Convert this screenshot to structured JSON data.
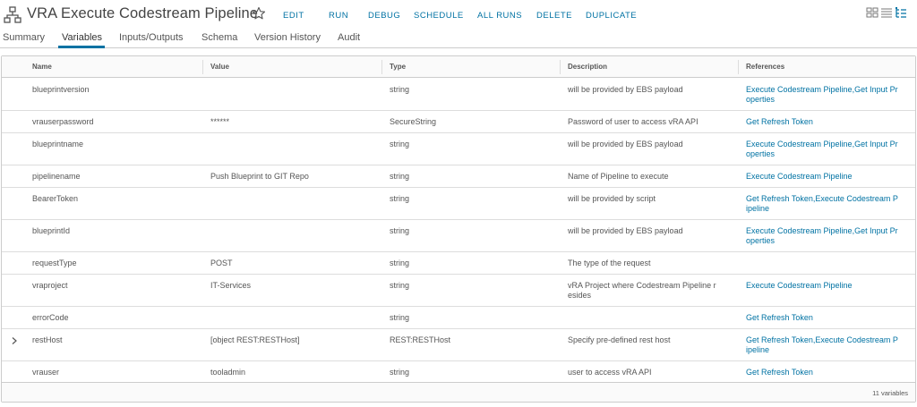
{
  "header": {
    "title": "VRA Execute Codestream Pipeline",
    "actions": [
      "EDIT",
      "RUN",
      "DEBUG",
      "SCHEDULE",
      "ALL RUNS",
      "DELETE",
      "DUPLICATE"
    ],
    "view_toggles": [
      "card-view-icon",
      "list-view-icon",
      "tree-view-icon"
    ]
  },
  "tabs": [
    {
      "label": "Summary",
      "active": false
    },
    {
      "label": "Variables",
      "active": true
    },
    {
      "label": "Inputs/Outputs",
      "active": false
    },
    {
      "label": "Schema",
      "active": false
    },
    {
      "label": "Version History",
      "active": false
    },
    {
      "label": "Audit",
      "active": false
    }
  ],
  "grid": {
    "columns": [
      "Name",
      "Value",
      "Type",
      "Description",
      "References"
    ],
    "rows": [
      {
        "name": "blueprintversion",
        "value": "",
        "type": "string",
        "description": "will be provided by EBS payload",
        "references": "Execute Codestream Pipeline,Get Input Pr operties",
        "expandable": false
      },
      {
        "name": "vrauserpassword",
        "value": "******",
        "type": "SecureString",
        "description": "Password of user to access vRA API",
        "references": "Get Refresh Token",
        "expandable": false
      },
      {
        "name": "blueprintname",
        "value": "",
        "type": "string",
        "description": "will be provided by EBS payload",
        "references": "Execute Codestream Pipeline,Get Input Pr operties",
        "expandable": false
      },
      {
        "name": "pipelinename",
        "value": "Push Blueprint to GIT Repo",
        "type": "string",
        "description": "Name of Pipeline to execute",
        "references": "Execute Codestream Pipeline",
        "expandable": false
      },
      {
        "name": "BearerToken",
        "value": "",
        "type": "string",
        "description": "will be provided by script",
        "references": "Get Refresh Token,Execute Codestream P ipeline",
        "expandable": false
      },
      {
        "name": "blueprintId",
        "value": "",
        "type": "string",
        "description": "will be provided by EBS payload",
        "references": "Execute Codestream Pipeline,Get Input Pr operties",
        "expandable": false
      },
      {
        "name": "requestType",
        "value": "POST",
        "type": "string",
        "description": "The type of the request",
        "references": "",
        "expandable": false
      },
      {
        "name": "vraproject",
        "value": "IT-Services",
        "type": "string",
        "description": "vRA Project where Codestream Pipeline r esides",
        "references": "Execute Codestream Pipeline",
        "expandable": false
      },
      {
        "name": "errorCode",
        "value": "",
        "type": "string",
        "description": "",
        "references": "Get Refresh Token",
        "expandable": false
      },
      {
        "name": "restHost",
        "value": "[object REST:RESTHost]",
        "type": "REST:RESTHost",
        "description": "Specify pre-defined rest host",
        "references": "Get Refresh Token,Execute Codestream P ipeline",
        "expandable": true
      },
      {
        "name": "vrauser",
        "value": "tooladmin",
        "type": "string",
        "description": "user to access vRA API",
        "references": "Get Refresh Token",
        "expandable": false
      }
    ],
    "footer": "11 variables"
  },
  "colors": {
    "accent": "#0072a3",
    "border": "#cccccc",
    "text": "#555555"
  }
}
